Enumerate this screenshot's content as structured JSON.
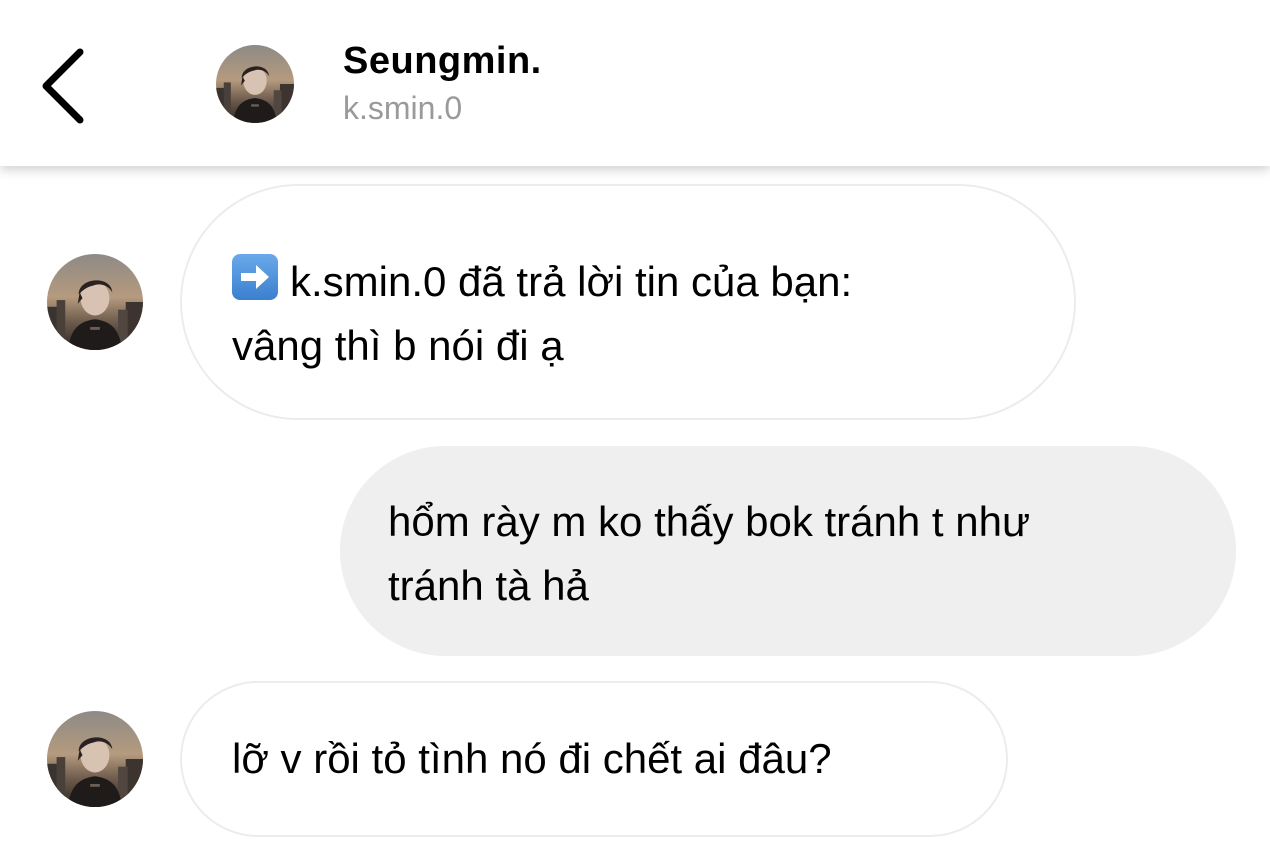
{
  "header": {
    "name": "Seungmin.",
    "username": "k.smin.0"
  },
  "icons": {
    "back": "chevron-left-icon",
    "reply_arrow": "right-arrow-emoji"
  },
  "colors": {
    "incoming_bubble": "#ffffff",
    "incoming_border": "#ececec",
    "outgoing_bubble": "#efefef",
    "username_gray": "#9a9a9a"
  },
  "messages": [
    {
      "direction": "incoming",
      "has_reply_icon": true,
      "lines": [
        "k.smin.0 đã trả lời tin của bạn:",
        "vâng thì b nói đi ạ"
      ]
    },
    {
      "direction": "outgoing",
      "lines": [
        "hổm rày m ko thấy bok tránh t như",
        "tránh tà hả"
      ]
    },
    {
      "direction": "incoming",
      "lines": [
        "lỡ v rồi tỏ tình nó đi chết ai đâu?"
      ]
    }
  ]
}
